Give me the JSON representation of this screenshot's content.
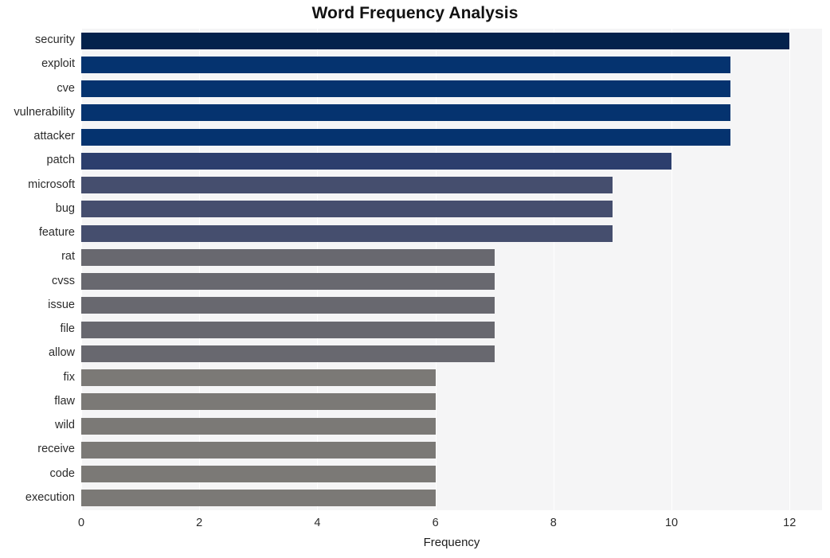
{
  "chart_data": {
    "type": "bar",
    "orientation": "horizontal",
    "title": "Word Frequency Analysis",
    "xlabel": "Frequency",
    "ylabel": "",
    "xlim": [
      0,
      12.55
    ],
    "xticks": [
      0,
      2,
      4,
      6,
      8,
      10,
      12
    ],
    "xtick_labels": [
      "0",
      "2",
      "4",
      "6",
      "8",
      "10",
      "12"
    ],
    "grid": "vertical-only",
    "legend": "none",
    "categories": [
      "security",
      "exploit",
      "cve",
      "vulnerability",
      "attacker",
      "patch",
      "microsoft",
      "bug",
      "feature",
      "rat",
      "cvss",
      "issue",
      "file",
      "allow",
      "fix",
      "flaw",
      "wild",
      "receive",
      "code",
      "execution"
    ],
    "values": [
      12,
      11,
      11,
      11,
      11,
      10,
      9,
      9,
      9,
      7,
      7,
      7,
      7,
      7,
      6,
      6,
      6,
      6,
      6,
      6
    ],
    "bar_colors": [
      "#04224c",
      "#05336f",
      "#05336f",
      "#05336f",
      "#05336f",
      "#2c3e6d",
      "#454e6e",
      "#454e6e",
      "#454e6e",
      "#68686f",
      "#68686f",
      "#68686f",
      "#68686f",
      "#68686f",
      "#7b7976",
      "#7b7976",
      "#7b7976",
      "#7b7976",
      "#7b7976",
      "#7b7976"
    ],
    "plot_background": "#f5f5f6",
    "gridline_color": "#ffffff",
    "figure_background": "#ffffff"
  }
}
